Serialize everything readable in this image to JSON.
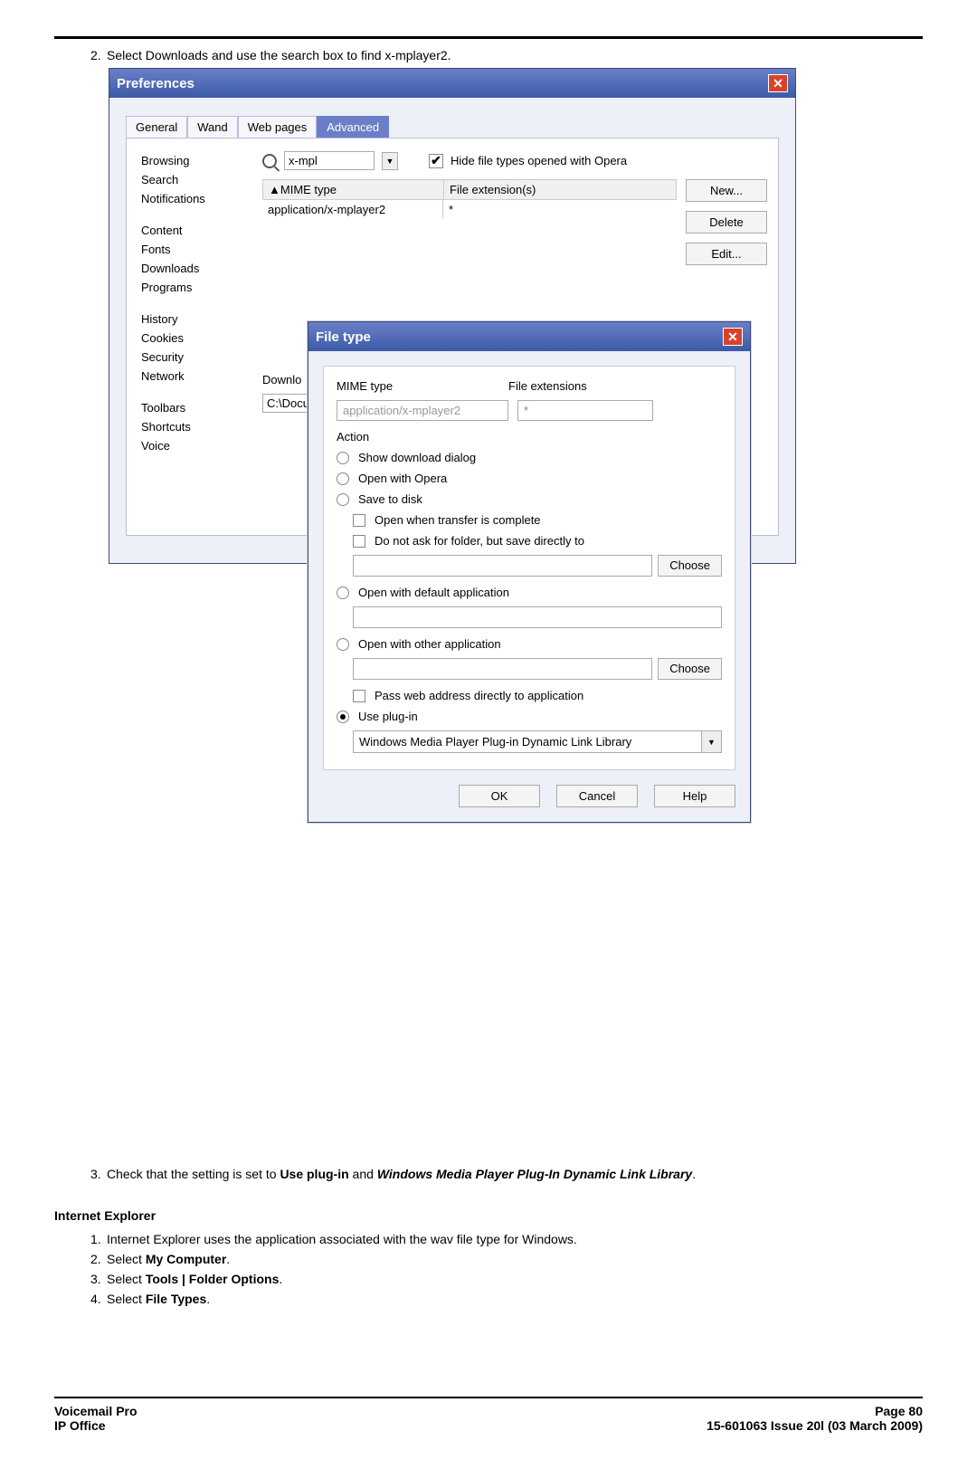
{
  "doc": {
    "step2": "Select Downloads and use the search box to find x-mplayer2.",
    "step3_pre": "Check that the setting is set to ",
    "step3_b1": "Use plug-in",
    "step3_mid": " and ",
    "step3_b2": "Windows Media Player Plug-In Dynamic Link Library",
    "step3_end": ".",
    "ie_head": "Internet Explorer",
    "ie1": "Internet Explorer uses the application associated with the wav file type for Windows.",
    "ie2a": "Select ",
    "ie2b": "My Computer",
    "ie3a": "Select ",
    "ie3b": "Tools | Folder Options",
    "ie4a": "Select ",
    "ie4b": "File Types",
    "footer_l1": "Voicemail Pro",
    "footer_l2": "IP Office",
    "footer_r1": "Page 80",
    "footer_r2": "15-601063 Issue 20l (03 March 2009)"
  },
  "prefs": {
    "title": "Preferences",
    "tabs": [
      "General",
      "Wand",
      "Web pages",
      "Advanced"
    ],
    "sidebar": {
      "g1": [
        "Browsing",
        "Search",
        "Notifications"
      ],
      "g2": [
        "Content",
        "Fonts",
        "Downloads",
        "Programs"
      ],
      "g3": [
        "History",
        "Cookies",
        "Security",
        "Network"
      ],
      "g4": [
        "Toolbars",
        "Shortcuts",
        "Voice"
      ]
    },
    "search_value": "x-mpl",
    "hide_label": "Hide file types opened with Opera",
    "col_mime": "MIME type",
    "col_ext": "File extension(s)",
    "row_mime": "application/x-mplayer2",
    "row_ext": "*",
    "btn_new": "New...",
    "btn_delete": "Delete",
    "btn_edit": "Edit...",
    "dl_label": "Downlo",
    "dl_path": "C:\\Docu"
  },
  "ft": {
    "title": "File type",
    "mime_label": "MIME type",
    "ext_label": "File extensions",
    "mime_val": "application/x-mplayer2",
    "ext_val": "*",
    "action_label": "Action",
    "opt_show": "Show download dialog",
    "opt_opera": "Open with Opera",
    "opt_save": "Save to disk",
    "chk_complete": "Open when transfer is complete",
    "chk_noask": "Do not ask for folder, but save directly to",
    "choose": "Choose",
    "opt_default": "Open with default application",
    "opt_other": "Open with other application",
    "chk_pass": "Pass web address directly to application",
    "opt_plugin": "Use plug-in",
    "plugin_value": "Windows Media Player Plug-in Dynamic Link Library",
    "ok": "OK",
    "cancel": "Cancel",
    "help": "Help"
  }
}
